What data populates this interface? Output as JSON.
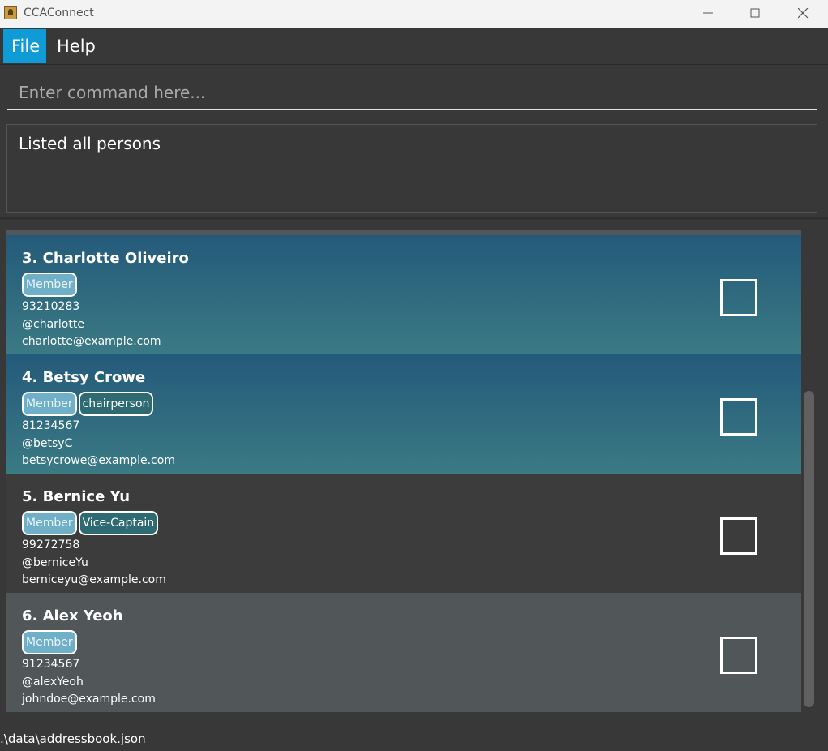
{
  "window": {
    "title": "CCAConnect"
  },
  "menu": {
    "file": "File",
    "help": "Help"
  },
  "command": {
    "placeholder": "Enter command here...",
    "value": ""
  },
  "result": {
    "text": "Listed all persons"
  },
  "persons": [
    {
      "name": "3. Charlotte Oliveiro",
      "tags": [
        "Member"
      ],
      "phone": "93210283",
      "handle": "@charlotte",
      "email": "charlotte@example.com",
      "checked": false
    },
    {
      "name": "4. Betsy Crowe",
      "tags": [
        "Member",
        "chairperson"
      ],
      "phone": "81234567",
      "handle": "@betsyC",
      "email": "betsycrowe@example.com",
      "checked": false
    },
    {
      "name": "5. Bernice Yu",
      "tags": [
        "Member",
        "Vice-Captain"
      ],
      "phone": "99272758",
      "handle": "@berniceYu",
      "email": "berniceyu@example.com",
      "checked": false
    },
    {
      "name": "6. Alex Yeoh",
      "tags": [
        "Member"
      ],
      "phone": "91234567",
      "handle": "@alexYeoh",
      "email": "johndoe@example.com",
      "checked": false
    }
  ],
  "status": {
    "path": ".\\data\\addressbook.json"
  },
  "colors": {
    "accent": "#0e9bd6",
    "background": "#383838",
    "selected_card_top": "#245a7a",
    "selected_card_bottom": "#3a7a84",
    "member_tag": "#6fb0c8",
    "role_tag": "#2e6a72"
  }
}
